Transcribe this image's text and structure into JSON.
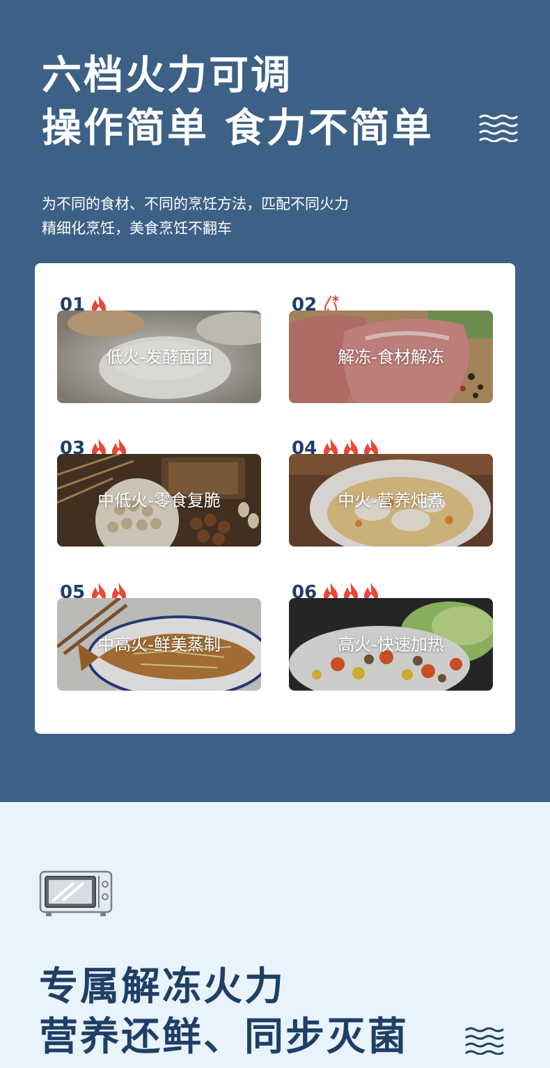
{
  "hero": {
    "title_line1": "六档火力可调",
    "title_line2": "操作简单 食力不简单",
    "subtitle_line1": "为不同的食材、不同的烹饪方法，匹配不同火力",
    "subtitle_line2": "精细化烹饪，美食烹饪不翻车",
    "decoration_icon": "wave-lines-icon"
  },
  "modes": [
    {
      "number": "01",
      "label": "低火-发酵面团",
      "icon": "flame-icon",
      "flame_count": 1
    },
    {
      "number": "02",
      "label": "解冻-食材解冻",
      "icon": "water-drop-snowflake-icon",
      "flame_count": 0
    },
    {
      "number": "03",
      "label": "中低火-零食复脆",
      "icon": "flame-icon",
      "flame_count": 2
    },
    {
      "number": "04",
      "label": "中火-营养炖煮",
      "icon": "flame-icon",
      "flame_count": 3
    },
    {
      "number": "05",
      "label": "中高火-鲜美蒸制",
      "icon": "flame-icon",
      "flame_count": 2
    },
    {
      "number": "06",
      "label": "高火-快速加热",
      "icon": "flame-icon",
      "flame_count": 3
    }
  ],
  "section2": {
    "icon": "microwave-icon",
    "title_line1": "专属解冻火力",
    "title_line2": "营养还鲜、同步灭菌",
    "decoration_icon": "wave-lines-icon"
  },
  "colors": {
    "top_background": "#3d6186",
    "bottom_background": "#e9f3fb",
    "number_text": "#1f3f66",
    "flame": "#e8473c",
    "heading_dark": "#1f3f66"
  }
}
